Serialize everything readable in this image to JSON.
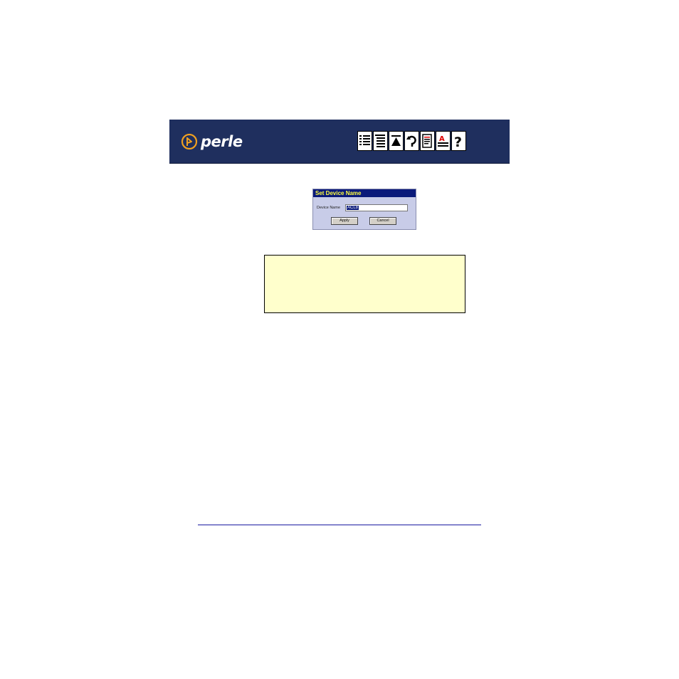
{
  "banner": {
    "logo_text": "perle",
    "background_color": "#1f2f5e",
    "logo_color": "#f0a020",
    "toolbar_icons": [
      "contents-list-icon",
      "index-list-icon",
      "up-arrow-icon",
      "back-arrow-icon",
      "document-icon",
      "text-format-icon",
      "help-question-icon"
    ]
  },
  "dialog": {
    "title": "Set Device Name",
    "field_label": "Device Name",
    "field_value": "ACL8",
    "apply_label": "Apply",
    "cancel_label": "Cancel",
    "title_bar_color": "#0a1a7a",
    "title_text_color": "#ffff40"
  },
  "note": {
    "background_color": "#ffffcc"
  }
}
